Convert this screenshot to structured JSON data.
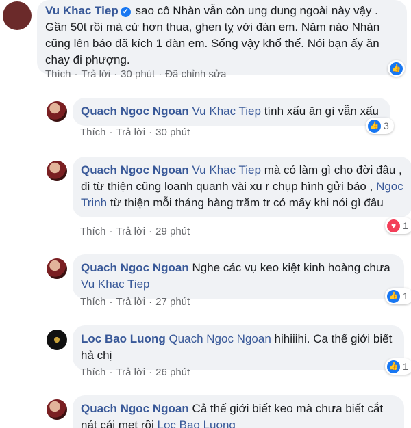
{
  "comments": [
    {
      "author": "Vu Khac Tiep",
      "text": "sao cô Nhàn vẫn còn ung dung ngoài này vậy . Gần 50t rồi mà cứ hơn thua, ghen tỵ với đàn em. Năm nào Nhàn cũng lên báo đã kích 1 đàn em. Sống vậy khổ thế. Nói bạn ấy ăn chay đi phượng.",
      "like": "Thích",
      "reply": "Trả lời",
      "time": "30 phút",
      "edited": "Đã chỉnh sửa",
      "reaction_icon": "like-icon",
      "reaction_count": ""
    },
    {
      "author": "Quach Ngoc Ngoan",
      "mention": "Vu Khac Tiep",
      "text": "tính xấu ăn gì vẫn xấu",
      "like": "Thích",
      "reply": "Trả lời",
      "time": "30 phút",
      "reaction_icon": "like-icon",
      "reaction_count": "3"
    },
    {
      "author": "Quach Ngoc Ngoan",
      "mention": "Vu Khac Tiep",
      "text": "mà có làm gì cho đời đâu , đi từ thiện cũng loanh quanh vài xu r chụp hình gửi báo ,",
      "mention2": "Ngoc Trinh",
      "text2": "từ thiện mỗi tháng hàng trăm tr có mấy khi nói gì đâu",
      "like": "Thích",
      "reply": "Trả lời",
      "time": "29 phút",
      "reaction_icon": "love-icon",
      "reaction_count": "1"
    },
    {
      "author": "Quach Ngoc Ngoan",
      "text": "Nghe các vụ keo kiệt kinh hoàng chưa",
      "mention": "Vu Khac Tiep",
      "like": "Thích",
      "reply": "Trả lời",
      "time": "27 phút",
      "reaction_icon": "like-icon",
      "reaction_count": "1"
    },
    {
      "author": "Loc Bao Luong",
      "mention": "Quach Ngoc Ngoan",
      "text": "hihiiihi. Ca thế giới biết hả chị",
      "like": "Thích",
      "reply": "Trả lời",
      "time": "26 phút",
      "reaction_icon": "like-icon",
      "reaction_count": "1"
    },
    {
      "author": "Quach Ngoc Ngoan",
      "text": "Cả thế giới biết keo mà chưa biết cắt nát cái mẹt rồi",
      "mention": "Loc Bao Luong"
    }
  ],
  "colors": {
    "name": "#385898",
    "bubble": "#f0f2f5",
    "meta": "#65676b",
    "like": "#1877f2",
    "love": "#f33e58"
  }
}
